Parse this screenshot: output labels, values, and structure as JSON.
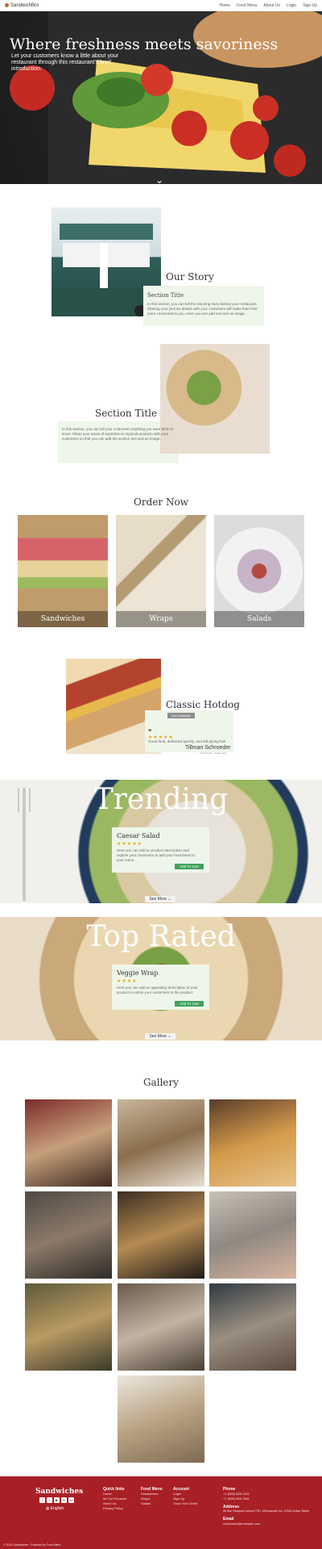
{
  "nav": {
    "brand": "SandwichBro",
    "links": [
      "Home",
      "Food Menu",
      "About Us",
      "Login",
      "Sign Up"
    ]
  },
  "hero": {
    "title": "Where freshness meets savoriness",
    "subtitle": "Let your customers know a little about your restaurant through this restaurant's brief introduction."
  },
  "story": {
    "heading": "Our Story",
    "section_title": "Section Title",
    "body": "In this section, you can tell the inspiring story behind your restaurant. Sharing your journey details with your customers will make them feel more connected to you. Here you can add text and an image.",
    "section_title_2": "Section Title",
    "body_2": "In this section, you can tell your customers anything you want them to know. Share your areas of expertise or regional products with your customers so that you can add the section text and an image."
  },
  "order_now": {
    "heading": "Order Now",
    "categories": [
      "Sandwiches",
      "Wraps",
      "Salads"
    ]
  },
  "featured": {
    "title": "Classic Hotdog",
    "badge": "Not Available",
    "rating": "★★★★★",
    "quote": "Great food, delivered quickly, and still piping hot!",
    "reviewer": "Tillman Schroeder",
    "reviewer_meta": "Great Food · 2 days ago"
  },
  "trending": {
    "word": "Trending",
    "item_name": "Caesar Salad",
    "rating": "★★★★★",
    "desc": "Here you can add an product description and explain your customers to add your food items to your menu.",
    "add_label": "Add To Cart",
    "see_more": "See More"
  },
  "top_rated": {
    "word": "Top Rated",
    "item_name": "Veggie Wrap",
    "rating": "★★★★",
    "desc": "Here you can add an appealing description of your product to entice your customers to the product.",
    "add_label": "Add To Cart",
    "see_more": "See More"
  },
  "gallery": {
    "heading": "Gallery"
  },
  "footer": {
    "brand": "Sandwiches",
    "social": [
      "f",
      "t",
      "▶",
      "◎",
      "in"
    ],
    "language": "English",
    "quick_links": {
      "title": "Quick links",
      "items": [
        "Home",
        "All Our Products",
        "About Us",
        "Privacy Policy"
      ]
    },
    "food_menu": {
      "title": "Food Menu",
      "items": [
        "Sandwiches",
        "Wraps",
        "Salads"
      ]
    },
    "account": {
      "title": "Account",
      "items": [
        "Login",
        "Sign Up",
        "Track Your Order"
      ]
    },
    "phone": {
      "title": "Phone",
      "items": [
        "+1 (555) 555-1321",
        "+1 (555) 985-7891"
      ]
    },
    "address": {
      "title": "Address",
      "value": "56 San Pasquale Avenue RR1, Minneapolis Inc, 12345 United States"
    },
    "email": {
      "title": "Email",
      "value": "customers@example.com"
    },
    "copyright": "© 2024 Sandwiches · Powered by Food Menu"
  },
  "colors": {
    "footer_bg": "#a81f25",
    "accent_green": "#3fa25a",
    "star": "#e4a719"
  }
}
